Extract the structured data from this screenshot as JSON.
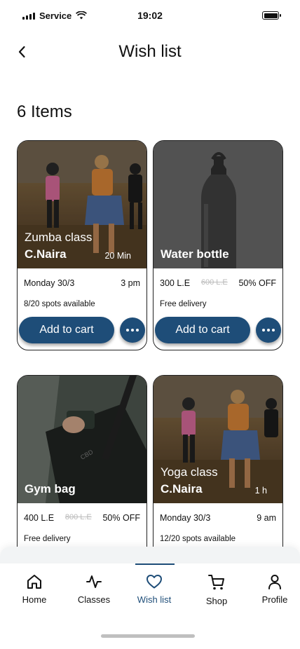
{
  "status_bar": {
    "carrier": "Service",
    "time": "19:02"
  },
  "header": {
    "title": "Wish list"
  },
  "items_count": "6 Items",
  "cards": [
    {
      "title": "Zumba class",
      "subtitle": "C.Naira",
      "duration": "20 Min",
      "date": "Monday 30/3",
      "time": "3 pm",
      "info": "8/20 spots available",
      "cart_label": "Add to cart"
    },
    {
      "title": "Water bottle",
      "price": "300 L.E",
      "old_price": "600 L.E",
      "discount": "50% OFF",
      "info": "Free delivery",
      "cart_label": "Add to cart"
    },
    {
      "title": "Gym bag",
      "price": "400 L.E",
      "old_price": "800 L.E",
      "discount": "50% OFF",
      "info": "Free delivery"
    },
    {
      "title": "Yoga class",
      "subtitle": "C.Naira",
      "duration": "1 h",
      "date": "Monday 30/3",
      "time": "9 am",
      "info": "12/20 spots  available"
    }
  ],
  "tabs": [
    {
      "label": "Home",
      "icon": "home-icon"
    },
    {
      "label": "Classes",
      "icon": "activity-icon"
    },
    {
      "label": "Wish list",
      "icon": "heart-icon",
      "active": true
    },
    {
      "label": "Shop",
      "icon": "cart-icon"
    },
    {
      "label": "Profile",
      "icon": "user-icon"
    }
  ],
  "colors": {
    "primary": "#1e4d78"
  }
}
